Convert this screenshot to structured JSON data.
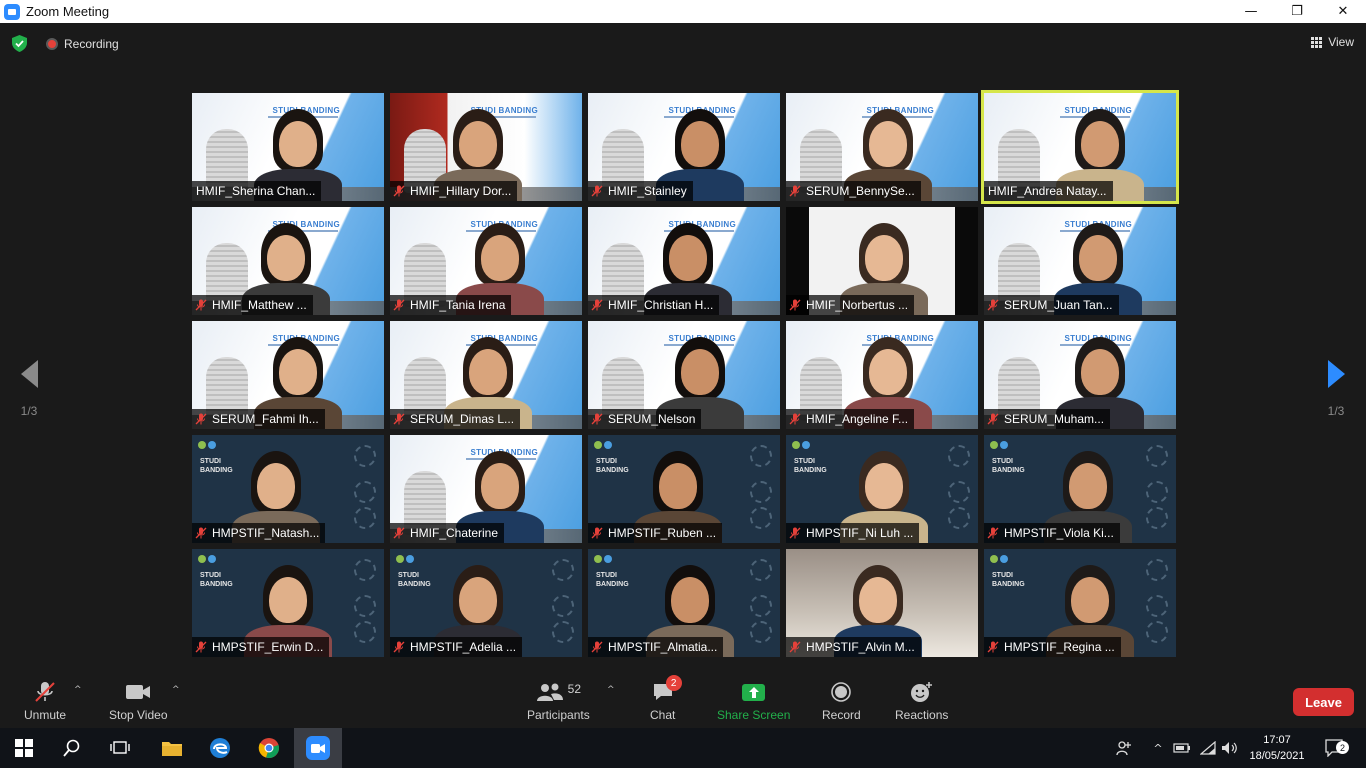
{
  "window": {
    "title": "Zoom Meeting",
    "controls": [
      "—",
      "❐",
      "✕"
    ]
  },
  "topbar": {
    "recording_label": "Recording",
    "view_label": "View"
  },
  "pager": {
    "left": "1/3",
    "right": "1/3"
  },
  "participants": [
    {
      "name": "HMIF_Sherina Chan...",
      "muted": false,
      "bg": "light",
      "active": false
    },
    {
      "name": "HMIF_Hillary Dor...",
      "muted": true,
      "bg": "red",
      "active": false
    },
    {
      "name": "HMIF_Stainley",
      "muted": true,
      "bg": "light",
      "active": false
    },
    {
      "name": "SERUM_BennySe...",
      "muted": true,
      "bg": "light",
      "active": false
    },
    {
      "name": "HMIF_Andrea Natay...",
      "muted": false,
      "bg": "light",
      "active": true
    },
    {
      "name": "HMIF_Matthew ...",
      "muted": true,
      "bg": "light",
      "active": false
    },
    {
      "name": "HMIF_Tania Irena",
      "muted": true,
      "bg": "light",
      "active": false
    },
    {
      "name": "HMIF_Christian H...",
      "muted": true,
      "bg": "light",
      "active": false
    },
    {
      "name": "HMIF_Norbertus ...",
      "muted": true,
      "bg": "black",
      "active": false
    },
    {
      "name": "SERUM_Juan Tan...",
      "muted": true,
      "bg": "light",
      "active": false
    },
    {
      "name": "SERUM_Fahmi Ih...",
      "muted": true,
      "bg": "light",
      "active": false
    },
    {
      "name": "SERUM_Dimas L...",
      "muted": true,
      "bg": "light",
      "active": false
    },
    {
      "name": "SERUM_Nelson",
      "muted": true,
      "bg": "light",
      "active": false
    },
    {
      "name": "HMIF_Angeline F...",
      "muted": true,
      "bg": "light",
      "active": false
    },
    {
      "name": "SERUM_Muham...",
      "muted": true,
      "bg": "light",
      "active": false
    },
    {
      "name": "HMPSTIF_Natash...",
      "muted": true,
      "bg": "dark",
      "active": false
    },
    {
      "name": "HMIF_Chaterine",
      "muted": true,
      "bg": "light",
      "active": false
    },
    {
      "name": "HMPSTIF_Ruben ...",
      "muted": true,
      "bg": "dark",
      "active": false
    },
    {
      "name": "HMPSTIF_Ni Luh ...",
      "muted": true,
      "bg": "dark",
      "active": false
    },
    {
      "name": "HMPSTIF_Viola Ki...",
      "muted": true,
      "bg": "dark",
      "active": false
    },
    {
      "name": "HMPSTIF_Erwin D...",
      "muted": true,
      "bg": "dark",
      "active": false
    },
    {
      "name": "HMPSTIF_Adelia ...",
      "muted": true,
      "bg": "dark",
      "active": false
    },
    {
      "name": "HMPSTIF_Almatia...",
      "muted": true,
      "bg": "dark",
      "active": false
    },
    {
      "name": "HMPSTIF_Alvin M...",
      "muted": true,
      "bg": "room",
      "active": false
    },
    {
      "name": "HMPSTIF_Regina ...",
      "muted": true,
      "bg": "dark",
      "active": false
    }
  ],
  "tile_text": {
    "banner": "STUDI BANDING",
    "dark_banner": "STUDI BANDING"
  },
  "toolbar": {
    "unmute": "Unmute",
    "stop_video": "Stop Video",
    "participants": "Participants",
    "participants_count": "52",
    "chat": "Chat",
    "chat_badge": "2",
    "share_screen": "Share Screen",
    "record": "Record",
    "reactions": "Reactions",
    "leave": "Leave"
  },
  "taskbar": {
    "time": "17:07",
    "date": "18/05/2021",
    "notifications": "2"
  },
  "colors": {
    "accent_blue": "#2d8cff",
    "share_green": "#22b04b",
    "leave_red": "#d32f2f",
    "active_speaker": "#d6e64a"
  }
}
